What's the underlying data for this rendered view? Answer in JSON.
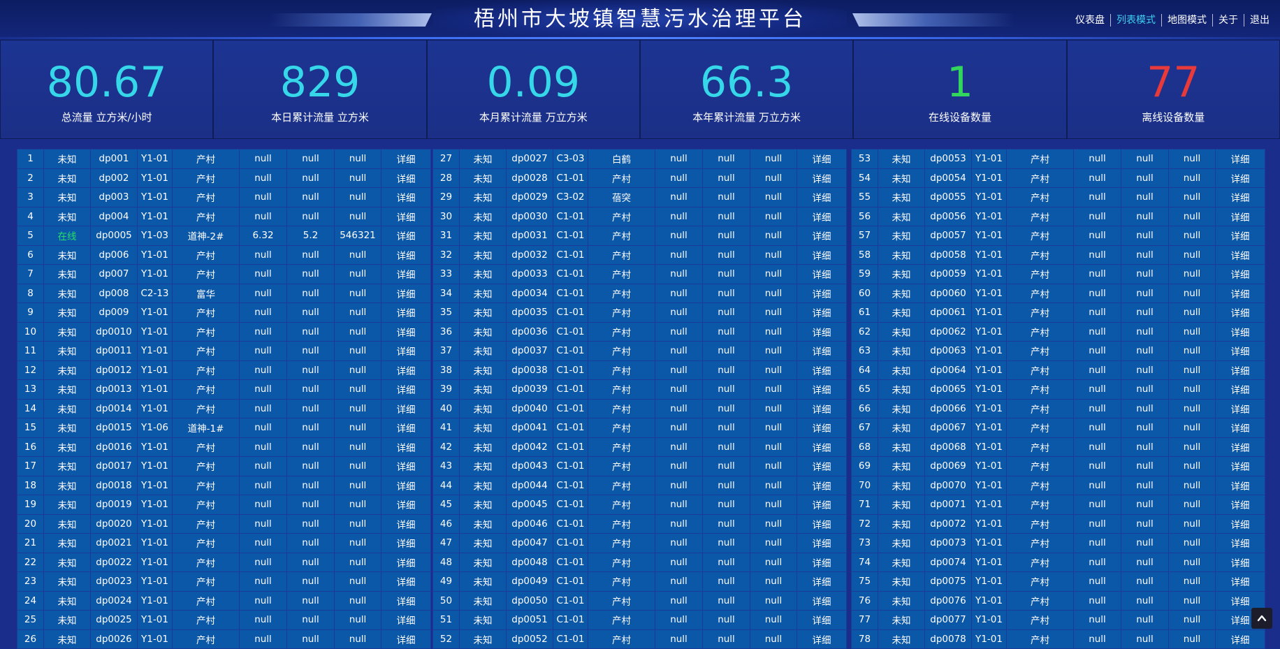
{
  "header": {
    "title": "梧州市大坡镇智慧污水治理平台",
    "nav": [
      "仪表盘",
      "列表模式",
      "地图模式",
      "关于",
      "退出"
    ],
    "active_nav": "列表模式"
  },
  "stats": [
    {
      "value": "80.67",
      "label": "总流量 立方米/小时",
      "color": "cyan"
    },
    {
      "value": "829",
      "label": "本日累计流量 立方米",
      "color": "cyan"
    },
    {
      "value": "0.09",
      "label": "本月累计流量 万立方米",
      "color": "cyan"
    },
    {
      "value": "66.3",
      "label": "本年累计流量 万立方米",
      "color": "cyan"
    },
    {
      "value": "1",
      "label": "在线设备数量",
      "color": "green"
    },
    {
      "value": "77",
      "label": "离线设备数量",
      "color": "red"
    }
  ],
  "colors": {
    "cyan": "#35d7e8",
    "green": "#33d65c",
    "red": "#e83a3a",
    "online": "#22e06a",
    "active_nav": "#3fd0f0",
    "cell_bg": "#0c58a8",
    "page_bg": "#1a2d8a"
  },
  "tables": [
    {
      "rows": [
        [
          "1",
          "未知",
          "dp001",
          "Y1-01",
          "产村",
          "null",
          "null",
          "null",
          "详细"
        ],
        [
          "2",
          "未知",
          "dp002",
          "Y1-01",
          "产村",
          "null",
          "null",
          "null",
          "详细"
        ],
        [
          "3",
          "未知",
          "dp003",
          "Y1-01",
          "产村",
          "null",
          "null",
          "null",
          "详细"
        ],
        [
          "4",
          "未知",
          "dp004",
          "Y1-01",
          "产村",
          "null",
          "null",
          "null",
          "详细"
        ],
        [
          "5",
          "在线",
          "dp0005",
          "Y1-03",
          "道神-2#",
          "6.32",
          "5.2",
          "546321",
          "详细"
        ],
        [
          "6",
          "未知",
          "dp006",
          "Y1-01",
          "产村",
          "null",
          "null",
          "null",
          "详细"
        ],
        [
          "7",
          "未知",
          "dp007",
          "Y1-01",
          "产村",
          "null",
          "null",
          "null",
          "详细"
        ],
        [
          "8",
          "未知",
          "dp008",
          "C2-13",
          "富华",
          "null",
          "null",
          "null",
          "详细"
        ],
        [
          "9",
          "未知",
          "dp009",
          "Y1-01",
          "产村",
          "null",
          "null",
          "null",
          "详细"
        ],
        [
          "10",
          "未知",
          "dp0010",
          "Y1-01",
          "产村",
          "null",
          "null",
          "null",
          "详细"
        ],
        [
          "11",
          "未知",
          "dp0011",
          "Y1-01",
          "产村",
          "null",
          "null",
          "null",
          "详细"
        ],
        [
          "12",
          "未知",
          "dp0012",
          "Y1-01",
          "产村",
          "null",
          "null",
          "null",
          "详细"
        ],
        [
          "13",
          "未知",
          "dp0013",
          "Y1-01",
          "产村",
          "null",
          "null",
          "null",
          "详细"
        ],
        [
          "14",
          "未知",
          "dp0014",
          "Y1-01",
          "产村",
          "null",
          "null",
          "null",
          "详细"
        ],
        [
          "15",
          "未知",
          "dp0015",
          "Y1-06",
          "道神-1#",
          "null",
          "null",
          "null",
          "详细"
        ],
        [
          "16",
          "未知",
          "dp0016",
          "Y1-01",
          "产村",
          "null",
          "null",
          "null",
          "详细"
        ],
        [
          "17",
          "未知",
          "dp0017",
          "Y1-01",
          "产村",
          "null",
          "null",
          "null",
          "详细"
        ],
        [
          "18",
          "未知",
          "dp0018",
          "Y1-01",
          "产村",
          "null",
          "null",
          "null",
          "详细"
        ],
        [
          "19",
          "未知",
          "dp0019",
          "Y1-01",
          "产村",
          "null",
          "null",
          "null",
          "详细"
        ],
        [
          "20",
          "未知",
          "dp0020",
          "Y1-01",
          "产村",
          "null",
          "null",
          "null",
          "详细"
        ],
        [
          "21",
          "未知",
          "dp0021",
          "Y1-01",
          "产村",
          "null",
          "null",
          "null",
          "详细"
        ],
        [
          "22",
          "未知",
          "dp0022",
          "Y1-01",
          "产村",
          "null",
          "null",
          "null",
          "详细"
        ],
        [
          "23",
          "未知",
          "dp0023",
          "Y1-01",
          "产村",
          "null",
          "null",
          "null",
          "详细"
        ],
        [
          "24",
          "未知",
          "dp0024",
          "Y1-01",
          "产村",
          "null",
          "null",
          "null",
          "详细"
        ],
        [
          "25",
          "未知",
          "dp0025",
          "Y1-01",
          "产村",
          "null",
          "null",
          "null",
          "详细"
        ],
        [
          "26",
          "未知",
          "dp0026",
          "Y1-01",
          "产村",
          "null",
          "null",
          "null",
          "详细"
        ]
      ]
    },
    {
      "rows": [
        [
          "27",
          "未知",
          "dp0027",
          "C3-03",
          "白鹤",
          "null",
          "null",
          "null",
          "详细"
        ],
        [
          "28",
          "未知",
          "dp0028",
          "C1-01",
          "产村",
          "null",
          "null",
          "null",
          "详细"
        ],
        [
          "29",
          "未知",
          "dp0029",
          "C3-02",
          "蓓突",
          "null",
          "null",
          "null",
          "详细"
        ],
        [
          "30",
          "未知",
          "dp0030",
          "C1-01",
          "产村",
          "null",
          "null",
          "null",
          "详细"
        ],
        [
          "31",
          "未知",
          "dp0031",
          "C1-01",
          "产村",
          "null",
          "null",
          "null",
          "详细"
        ],
        [
          "32",
          "未知",
          "dp0032",
          "C1-01",
          "产村",
          "null",
          "null",
          "null",
          "详细"
        ],
        [
          "33",
          "未知",
          "dp0033",
          "C1-01",
          "产村",
          "null",
          "null",
          "null",
          "详细"
        ],
        [
          "34",
          "未知",
          "dp0034",
          "C1-01",
          "产村",
          "null",
          "null",
          "null",
          "详细"
        ],
        [
          "35",
          "未知",
          "dp0035",
          "C1-01",
          "产村",
          "null",
          "null",
          "null",
          "详细"
        ],
        [
          "36",
          "未知",
          "dp0036",
          "C1-01",
          "产村",
          "null",
          "null",
          "null",
          "详细"
        ],
        [
          "37",
          "未知",
          "dp0037",
          "C1-01",
          "产村",
          "null",
          "null",
          "null",
          "详细"
        ],
        [
          "38",
          "未知",
          "dp0038",
          "C1-01",
          "产村",
          "null",
          "null",
          "null",
          "详细"
        ],
        [
          "39",
          "未知",
          "dp0039",
          "C1-01",
          "产村",
          "null",
          "null",
          "null",
          "详细"
        ],
        [
          "40",
          "未知",
          "dp0040",
          "C1-01",
          "产村",
          "null",
          "null",
          "null",
          "详细"
        ],
        [
          "41",
          "未知",
          "dp0041",
          "C1-01",
          "产村",
          "null",
          "null",
          "null",
          "详细"
        ],
        [
          "42",
          "未知",
          "dp0042",
          "C1-01",
          "产村",
          "null",
          "null",
          "null",
          "详细"
        ],
        [
          "43",
          "未知",
          "dp0043",
          "C1-01",
          "产村",
          "null",
          "null",
          "null",
          "详细"
        ],
        [
          "44",
          "未知",
          "dp0044",
          "C1-01",
          "产村",
          "null",
          "null",
          "null",
          "详细"
        ],
        [
          "45",
          "未知",
          "dp0045",
          "C1-01",
          "产村",
          "null",
          "null",
          "null",
          "详细"
        ],
        [
          "46",
          "未知",
          "dp0046",
          "C1-01",
          "产村",
          "null",
          "null",
          "null",
          "详细"
        ],
        [
          "47",
          "未知",
          "dp0047",
          "C1-01",
          "产村",
          "null",
          "null",
          "null",
          "详细"
        ],
        [
          "48",
          "未知",
          "dp0048",
          "C1-01",
          "产村",
          "null",
          "null",
          "null",
          "详细"
        ],
        [
          "49",
          "未知",
          "dp0049",
          "C1-01",
          "产村",
          "null",
          "null",
          "null",
          "详细"
        ],
        [
          "50",
          "未知",
          "dp0050",
          "C1-01",
          "产村",
          "null",
          "null",
          "null",
          "详细"
        ],
        [
          "51",
          "未知",
          "dp0051",
          "C1-01",
          "产村",
          "null",
          "null",
          "null",
          "详细"
        ],
        [
          "52",
          "未知",
          "dp0052",
          "C1-01",
          "产村",
          "null",
          "null",
          "null",
          "详细"
        ]
      ]
    },
    {
      "rows": [
        [
          "53",
          "未知",
          "dp0053",
          "Y1-01",
          "产村",
          "null",
          "null",
          "null",
          "详细"
        ],
        [
          "54",
          "未知",
          "dp0054",
          "Y1-01",
          "产村",
          "null",
          "null",
          "null",
          "详细"
        ],
        [
          "55",
          "未知",
          "dp0055",
          "Y1-01",
          "产村",
          "null",
          "null",
          "null",
          "详细"
        ],
        [
          "56",
          "未知",
          "dp0056",
          "Y1-01",
          "产村",
          "null",
          "null",
          "null",
          "详细"
        ],
        [
          "57",
          "未知",
          "dp0057",
          "Y1-01",
          "产村",
          "null",
          "null",
          "null",
          "详细"
        ],
        [
          "58",
          "未知",
          "dp0058",
          "Y1-01",
          "产村",
          "null",
          "null",
          "null",
          "详细"
        ],
        [
          "59",
          "未知",
          "dp0059",
          "Y1-01",
          "产村",
          "null",
          "null",
          "null",
          "详细"
        ],
        [
          "60",
          "未知",
          "dp0060",
          "Y1-01",
          "产村",
          "null",
          "null",
          "null",
          "详细"
        ],
        [
          "61",
          "未知",
          "dp0061",
          "Y1-01",
          "产村",
          "null",
          "null",
          "null",
          "详细"
        ],
        [
          "62",
          "未知",
          "dp0062",
          "Y1-01",
          "产村",
          "null",
          "null",
          "null",
          "详细"
        ],
        [
          "63",
          "未知",
          "dp0063",
          "Y1-01",
          "产村",
          "null",
          "null",
          "null",
          "详细"
        ],
        [
          "64",
          "未知",
          "dp0064",
          "Y1-01",
          "产村",
          "null",
          "null",
          "null",
          "详细"
        ],
        [
          "65",
          "未知",
          "dp0065",
          "Y1-01",
          "产村",
          "null",
          "null",
          "null",
          "详细"
        ],
        [
          "66",
          "未知",
          "dp0066",
          "Y1-01",
          "产村",
          "null",
          "null",
          "null",
          "详细"
        ],
        [
          "67",
          "未知",
          "dp0067",
          "Y1-01",
          "产村",
          "null",
          "null",
          "null",
          "详细"
        ],
        [
          "68",
          "未知",
          "dp0068",
          "Y1-01",
          "产村",
          "null",
          "null",
          "null",
          "详细"
        ],
        [
          "69",
          "未知",
          "dp0069",
          "Y1-01",
          "产村",
          "null",
          "null",
          "null",
          "详细"
        ],
        [
          "70",
          "未知",
          "dp0070",
          "Y1-01",
          "产村",
          "null",
          "null",
          "null",
          "详细"
        ],
        [
          "71",
          "未知",
          "dp0071",
          "Y1-01",
          "产村",
          "null",
          "null",
          "null",
          "详细"
        ],
        [
          "72",
          "未知",
          "dp0072",
          "Y1-01",
          "产村",
          "null",
          "null",
          "null",
          "详细"
        ],
        [
          "73",
          "未知",
          "dp0073",
          "Y1-01",
          "产村",
          "null",
          "null",
          "null",
          "详细"
        ],
        [
          "74",
          "未知",
          "dp0074",
          "Y1-01",
          "产村",
          "null",
          "null",
          "null",
          "详细"
        ],
        [
          "75",
          "未知",
          "dp0075",
          "Y1-01",
          "产村",
          "null",
          "null",
          "null",
          "详细"
        ],
        [
          "76",
          "未知",
          "dp0076",
          "Y1-01",
          "产村",
          "null",
          "null",
          "null",
          "详细"
        ],
        [
          "77",
          "未知",
          "dp0077",
          "Y1-01",
          "产村",
          "null",
          "null",
          "null",
          "详细"
        ],
        [
          "78",
          "未知",
          "dp0078",
          "Y1-01",
          "产村",
          "null",
          "null",
          "null",
          "详细"
        ]
      ]
    }
  ],
  "icons": {
    "scroll_top": "chevron-up-icon"
  }
}
